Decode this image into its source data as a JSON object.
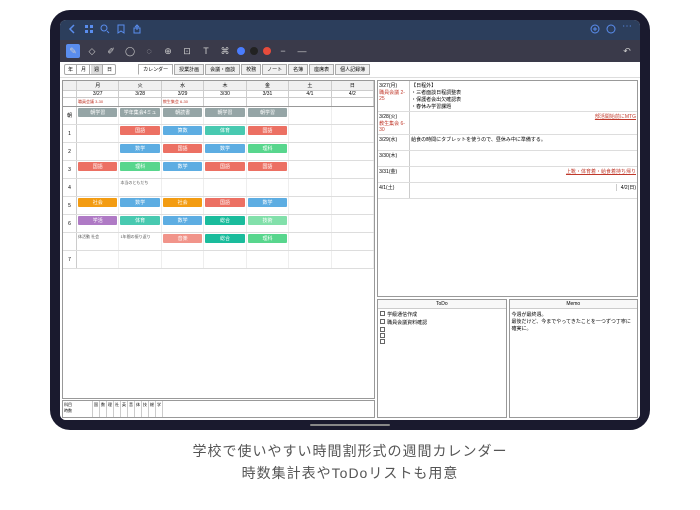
{
  "viewButtons": [
    "年",
    "月",
    "週",
    "日"
  ],
  "activeView": "週",
  "tabs": [
    "カレンダー",
    "授業計画",
    "会議・面談",
    "校務",
    "ノート",
    "名簿",
    "座席表",
    "個人記録簿"
  ],
  "activeTab": "カレンダー",
  "days": [
    "月",
    "火",
    "水",
    "木",
    "金",
    "土",
    "日"
  ],
  "dates": [
    "3/27",
    "3/28",
    "3/29",
    "3/30",
    "3/31",
    "4/1",
    "4/2"
  ],
  "topEvents": [
    "職員会議 3-30",
    "",
    "教生集会 6-30",
    "",
    "",
    "",
    ""
  ],
  "periods": [
    {
      "n": "朝",
      "cells": [
        {
          "t": "朝学習",
          "c": "s-gray"
        },
        {
          "t": "学年集会4ミュ",
          "note": "",
          "c": "s-gray"
        },
        {
          "t": "朝読書",
          "c": "s-gray"
        },
        {
          "t": "朝学習",
          "c": "s-gray"
        },
        {
          "t": "朝学習",
          "c": "s-gray"
        },
        {
          "t": "",
          "c": ""
        },
        {
          "t": "",
          "c": ""
        }
      ]
    },
    {
      "n": "1",
      "cells": [
        {
          "t": "",
          "c": ""
        },
        {
          "t": "国語",
          "c": "s-red"
        },
        {
          "t": "算数",
          "c": "s-blue"
        },
        {
          "t": "体育",
          "c": "s-cyan"
        },
        {
          "t": "国語",
          "c": "s-red"
        },
        {
          "t": "",
          "c": ""
        },
        {
          "t": "",
          "c": ""
        }
      ]
    },
    {
      "n": "2",
      "cells": [
        {
          "t": "",
          "c": ""
        },
        {
          "t": "数学",
          "c": "s-blue"
        },
        {
          "t": "国語",
          "c": "s-red"
        },
        {
          "t": "数学",
          "c": "s-blue"
        },
        {
          "t": "理科",
          "c": "s-green"
        },
        {
          "t": "",
          "c": ""
        },
        {
          "t": "",
          "c": ""
        }
      ]
    },
    {
      "n": "3",
      "cells": [
        {
          "t": "国語",
          "c": "s-red"
        },
        {
          "t": "理科",
          "c": "s-green"
        },
        {
          "t": "数学",
          "c": "s-blue"
        },
        {
          "t": "国語",
          "c": "s-red"
        },
        {
          "t": "国語",
          "c": "s-red"
        },
        {
          "t": "",
          "c": ""
        },
        {
          "t": "",
          "c": ""
        }
      ]
    },
    {
      "n": "4",
      "cells": [
        {
          "t": "",
          "c": ""
        },
        {
          "t": "",
          "note": "本当のともだち",
          "c": ""
        },
        {
          "t": "",
          "c": ""
        },
        {
          "t": "",
          "c": ""
        },
        {
          "t": "",
          "c": ""
        },
        {
          "t": "",
          "c": ""
        },
        {
          "t": "",
          "c": ""
        }
      ]
    },
    {
      "n": "5",
      "cells": [
        {
          "t": "社会",
          "c": "s-orange"
        },
        {
          "t": "数学",
          "c": "s-blue"
        },
        {
          "t": "社会",
          "c": "s-orange"
        },
        {
          "t": "国語",
          "c": "s-red"
        },
        {
          "t": "数学",
          "c": "s-blue"
        },
        {
          "t": "",
          "c": ""
        },
        {
          "t": "",
          "c": ""
        }
      ]
    },
    {
      "n": "6",
      "cells": [
        {
          "t": "学活",
          "c": "s-purple"
        },
        {
          "t": "体育",
          "c": "s-cyan"
        },
        {
          "t": "数学",
          "c": "s-blue"
        },
        {
          "t": "総合",
          "c": "s-teal"
        },
        {
          "t": "技術",
          "c": "s-lgreen"
        },
        {
          "t": "",
          "c": ""
        },
        {
          "t": "",
          "c": ""
        }
      ]
    },
    {
      "n": "",
      "cells": [
        {
          "t": "",
          "note": "体活動 社会",
          "c": ""
        },
        {
          "t": "",
          "note": "1年間の振り返り",
          "c": ""
        },
        {
          "t": "音楽",
          "c": "s-pink"
        },
        {
          "t": "総合",
          "c": "s-teal"
        },
        {
          "t": "理科",
          "c": "s-green"
        },
        {
          "t": "",
          "c": ""
        },
        {
          "t": "",
          "c": ""
        }
      ]
    },
    {
      "n": "7",
      "cells": [
        {
          "t": "",
          "c": ""
        },
        {
          "t": "",
          "c": ""
        },
        {
          "t": "",
          "c": ""
        },
        {
          "t": "",
          "c": ""
        },
        {
          "t": "",
          "c": ""
        },
        {
          "t": "",
          "c": ""
        },
        {
          "t": "",
          "c": ""
        }
      ]
    }
  ],
  "daily": [
    {
      "d": "3/27(月)",
      "red": "職員会議 2-25",
      "c": "【日程外】\n・三者面談日程調整表\n・保護者会出欠確認表\n・春休み学習課題"
    },
    {
      "d": "3/28(火)",
      "red": "教生集会 6-30",
      "c": "",
      "link": "部活開始前にMTG"
    },
    {
      "d": "3/29(水)",
      "c": "給食の時間にタブレットを使うので、昼休み中に準備する。"
    },
    {
      "d": "3/30(木)",
      "c": ""
    },
    {
      "d": "3/31(金)",
      "c": "",
      "link2": "上靴・体育着・給食着持ち帰り"
    },
    {
      "d": "4/1(土)",
      "c": "",
      "next": "4/2(日)"
    }
  ],
  "todoTitle": "ToDo",
  "todos": [
    "学級通信作成",
    "職員会議資料確認",
    "",
    "",
    ""
  ],
  "memoTitle": "Memo",
  "memo": "今週が最終週。\n最後だけど、今までやってきたことを一つずつ丁寧に確実に。",
  "caption1": "学校で使いやすい時間割形式の週間カレンダー",
  "caption2": "時数集計表やToDoリストも用意"
}
